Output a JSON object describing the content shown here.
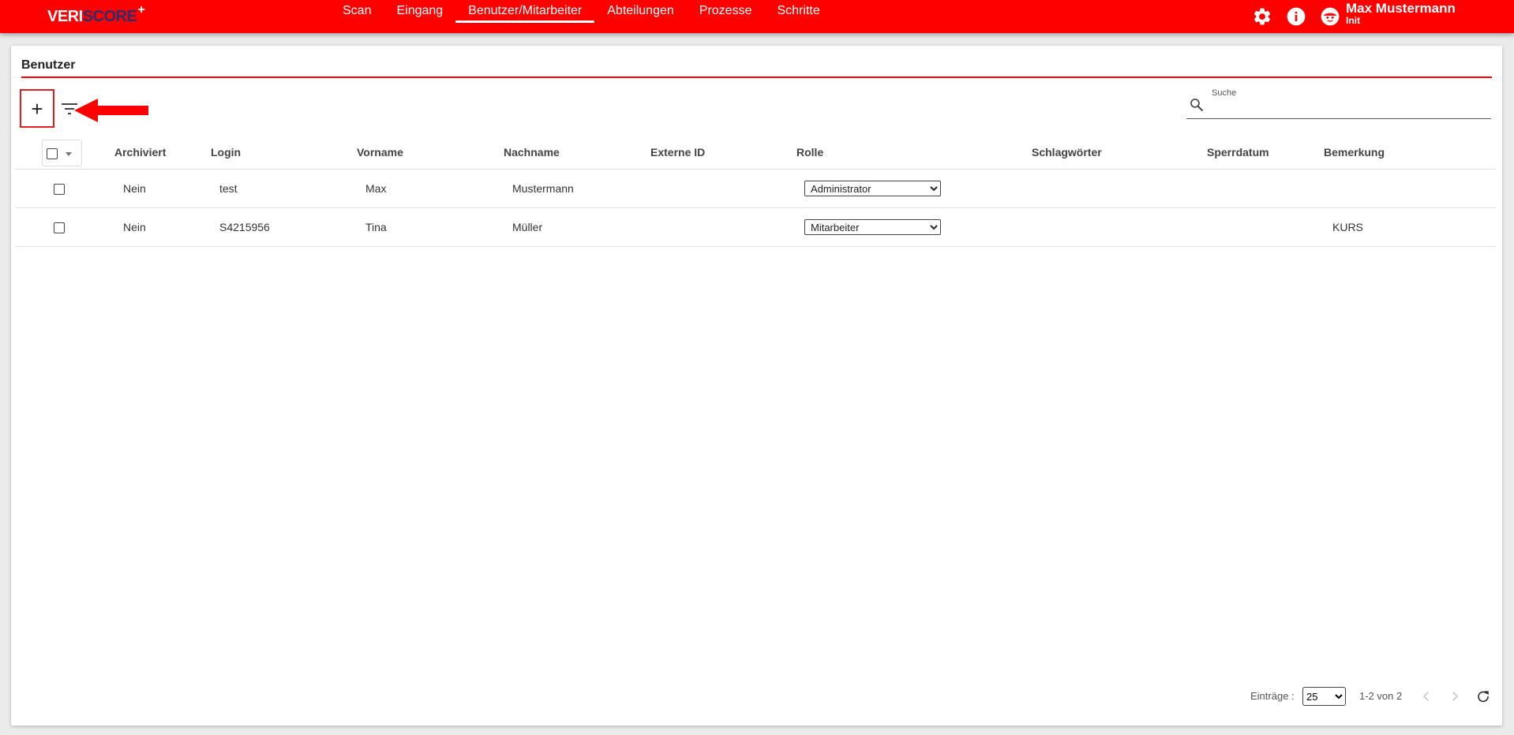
{
  "app": {
    "logo_part1": "VERI",
    "logo_part2": "SCORE",
    "logo_plus": "+",
    "brand_color": "#ff0000"
  },
  "nav": {
    "items": [
      {
        "label": "Scan"
      },
      {
        "label": "Eingang"
      },
      {
        "label": "Benutzer/Mitarbeiter",
        "active": true
      },
      {
        "label": "Abteilungen"
      },
      {
        "label": "Prozesse"
      },
      {
        "label": "Schritte"
      }
    ]
  },
  "header": {
    "icons": [
      "gear-icon",
      "info-icon",
      "user-avatar-icon"
    ],
    "user_name": "Max Mustermann",
    "user_sub": "Init"
  },
  "page": {
    "title": "Benutzer",
    "add_label": "+",
    "search": {
      "label": "Suche",
      "value": ""
    }
  },
  "table": {
    "headers": [
      "Archiviert",
      "Login",
      "Vorname",
      "Nachname",
      "Externe ID",
      "Rolle",
      "Schlagwörter",
      "Sperrdatum",
      "Bemerkung"
    ],
    "rows": [
      {
        "archiviert": "Nein",
        "login": "test",
        "vorname": "Max",
        "nachname": "Mustermann",
        "externe_id": "",
        "rolle": "Administrator",
        "schlagwoerter": "",
        "sperrdatum": "",
        "bemerkung": ""
      },
      {
        "archiviert": "Nein",
        "login": "S4215956",
        "vorname": "Tina",
        "nachname": "Müller",
        "externe_id": "",
        "rolle": "Mitarbeiter",
        "schlagwoerter": "",
        "sperrdatum": "",
        "bemerkung": "KURS"
      }
    ]
  },
  "pagination": {
    "entries_label": "Einträge :",
    "page_size": "25",
    "range": "1-2 von 2"
  }
}
